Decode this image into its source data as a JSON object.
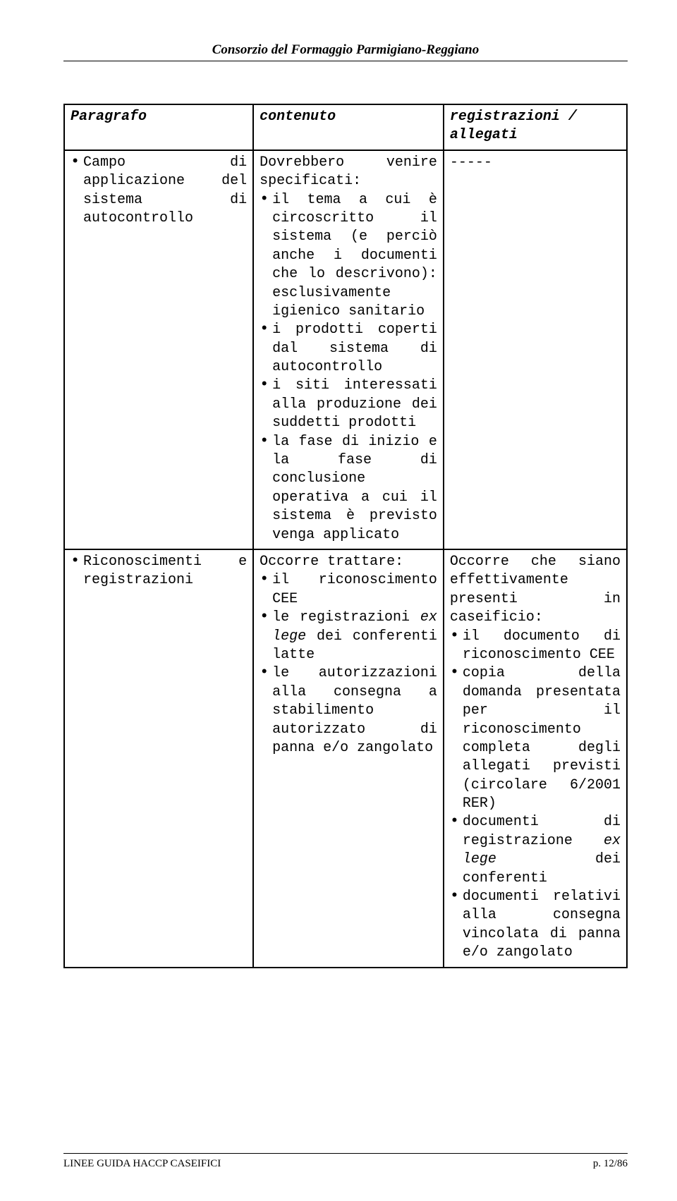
{
  "header": {
    "title": "Consorzio del Formaggio Parmigiano-Reggiano"
  },
  "table": {
    "headers": {
      "col1": "Paragrafo",
      "col2": "contenuto",
      "col3": "registrazioni / allegati"
    },
    "rows": [
      {
        "paragraph": {
          "main": "Campo di applicazione del sistema di autocontrollo"
        },
        "content": {
          "lead": "Dovrebbero venire specificati:",
          "items": [
            "il tema a cui è circoscritto il sistema (e perciò anche i documenti che lo descrivono): esclusivamente igienico sanitario",
            "i prodotti coperti dal sistema di autocontrollo",
            "i siti interessati alla produzione dei suddetti prodotti",
            "la fase di inizio e la fase di conclusione operativa a cui il sistema è previsto venga applicato"
          ]
        },
        "reg": {
          "text": "-----"
        }
      },
      {
        "paragraph": {
          "main": "Riconoscimenti e registrazioni"
        },
        "content": {
          "lead": "Occorre trattare:",
          "items_html": [
            {
              "pre": "il riconoscimento CEE"
            },
            {
              "pre": "le registrazioni ",
              "em": "ex lege",
              "post": " dei conferenti latte"
            },
            {
              "pre": "le autorizzazioni alla consegna a stabilimento autorizzato di panna e/o zangolato"
            }
          ]
        },
        "reg": {
          "lead": "Occorre che siano effettivamente presenti in caseificio:",
          "items_html": [
            {
              "pre": "il documento di riconoscimento CEE"
            },
            {
              "pre": "copia della domanda presentata per il riconoscimento completa degli allegati previsti (circolare 6/2001 RER)"
            },
            {
              "pre": "documenti di registrazione ",
              "em": "ex lege",
              "post": " dei conferenti"
            },
            {
              "pre": "documenti relativi alla consegna vincolata di panna e/o zangolato"
            }
          ]
        }
      }
    ]
  },
  "footer": {
    "left": "LINEE GUIDA HACCP CASEIFICI",
    "right": "p. 12/86"
  }
}
